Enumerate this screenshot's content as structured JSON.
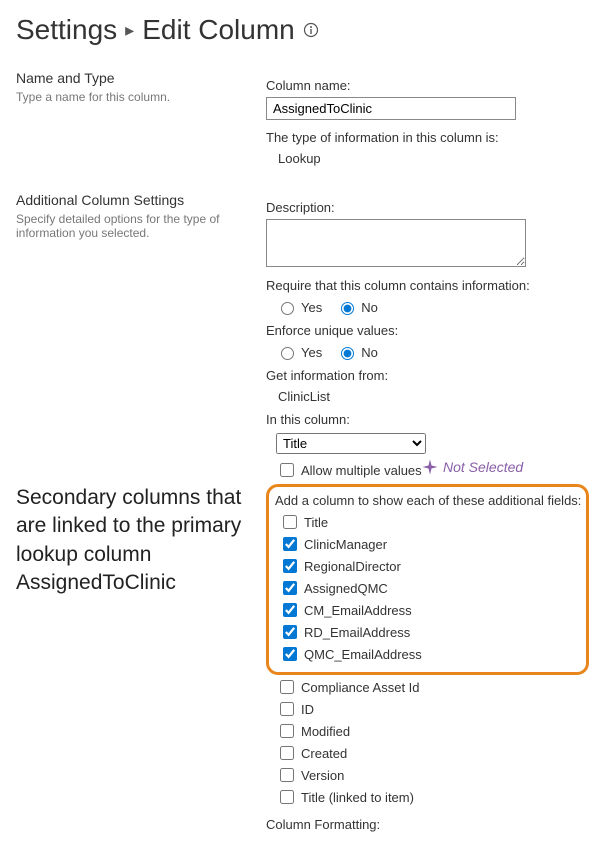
{
  "breadcrumb": {
    "root": "Settings",
    "sep": "▸",
    "current": "Edit Column"
  },
  "section1": {
    "title": "Name and Type",
    "desc": "Type a name for this column.",
    "colname_label": "Column name:",
    "colname_value": "AssignedToClinic",
    "type_label": "The type of information in this column is:",
    "type_value": "Lookup"
  },
  "section2": {
    "title": "Additional Column Settings",
    "desc": "Specify detailed options for the type of information you selected.",
    "desc_label": "Description:",
    "desc_value": "",
    "require_label": "Require that this column contains information:",
    "yes": "Yes",
    "no": "No",
    "require_value": "No",
    "unique_label": "Enforce unique values:",
    "unique_value": "No",
    "getinfo_label": "Get information from:",
    "getinfo_value": "ClinicList",
    "inthis_label": "In this column:",
    "inthis_value": "Title",
    "allow_mult": "Allow multiple values",
    "allow_mult_checked": false,
    "not_selected": "Not Selected",
    "addcol_label": "Add a column to show each of these additional fields:",
    "fields_highlight": [
      {
        "label": "Title",
        "checked": false
      },
      {
        "label": "ClinicManager",
        "checked": true
      },
      {
        "label": "RegionalDirector",
        "checked": true
      },
      {
        "label": "AssignedQMC",
        "checked": true
      },
      {
        "label": "CM_EmailAddress",
        "checked": true
      },
      {
        "label": "RD_EmailAddress",
        "checked": true
      },
      {
        "label": "QMC_EmailAddress",
        "checked": true
      }
    ],
    "fields_rest": [
      {
        "label": "Compliance Asset Id",
        "checked": false
      },
      {
        "label": "ID",
        "checked": false
      },
      {
        "label": "Modified",
        "checked": false
      },
      {
        "label": "Created",
        "checked": false
      },
      {
        "label": "Version",
        "checked": false
      },
      {
        "label": "Title (linked to item)",
        "checked": false
      }
    ],
    "colfmt_label": "Column Formatting:"
  },
  "annotation": "Secondary columns that are linked to the primary lookup column AssignedToClinic"
}
